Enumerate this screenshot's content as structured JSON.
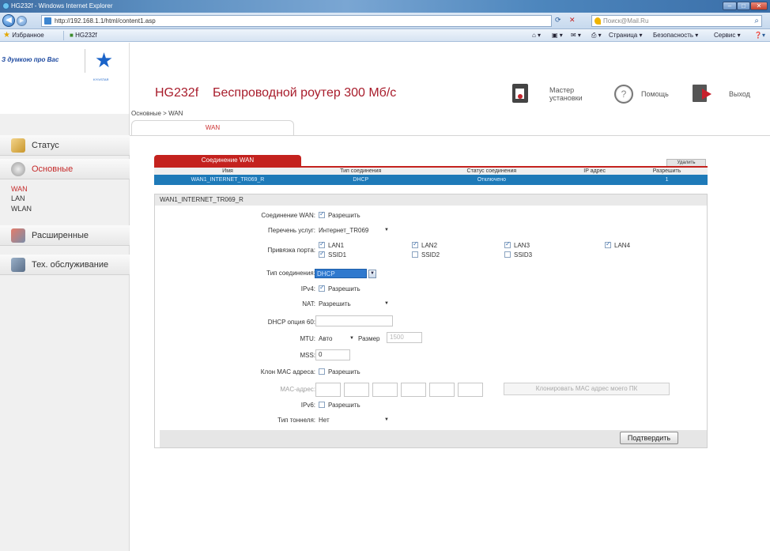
{
  "browser": {
    "window_title": "HG232f - Windows Internet Explorer",
    "url": "http://192.168.1.1/html/content1.asp",
    "search_placeholder": "Поиск@Mail.Ru",
    "favorites_label": "Избранное",
    "fav_tab_label": "HG232f",
    "commands": [
      "Страница ▾",
      "Безопасность ▾",
      "Сервис ▾"
    ]
  },
  "header": {
    "logo_slogan": "З думкою про Вас",
    "logo_brand": "KYIVSTAR",
    "model": "HG232f",
    "product": "Беспроводной роутер 300 Мб/с",
    "wizard_line1": "Мастер",
    "wizard_line2": "установки",
    "help": "Помощь",
    "exit": "Выход"
  },
  "breadcrumb": "Основные > WAN",
  "top_tab": "WAN",
  "sidebar": {
    "menu": [
      {
        "label": "Статус"
      },
      {
        "label": "Основные"
      },
      {
        "label": "Расширенные"
      },
      {
        "label": "Тех. обслуживание"
      }
    ],
    "sub": [
      "WAN",
      "LAN",
      "WLAN"
    ]
  },
  "wan_table": {
    "tab": "Соединение WAN",
    "delete_button": "Удалить",
    "headers": [
      "Имя",
      "Тип соединения",
      "Статус соединения",
      "IP адрес",
      "Разрешить"
    ],
    "row": [
      "WAN1_INTERNET_TR069_R",
      "DHCP",
      "Отключено",
      "",
      "1"
    ]
  },
  "form": {
    "title": "WAN1_INTERNET_TR069_R",
    "labels": {
      "wan_conn": "Соединение WAN:",
      "service_list": "Перечень услуг:",
      "port_binding": "Привязка порта:",
      "conn_type": "Тип соединения:",
      "ipv4": "IPv4:",
      "nat": "NAT:",
      "dhcp60": "DHCP опция 60:",
      "mtu": "MTU:",
      "mss": "MSS:",
      "mac_clone": "Клон MAC адреса:",
      "mac_addr": "MAC-адрес:",
      "ipv6": "IPv6:",
      "tunnel_type": "Тип тоннеля:"
    },
    "allow": "Разрешить",
    "service_list_value": "Интернет_TR069",
    "ports": [
      "LAN1",
      "LAN2",
      "LAN3",
      "LAN4",
      "SSID1",
      "SSID2",
      "SSID3"
    ],
    "port_checked": [
      true,
      true,
      true,
      true,
      true,
      false,
      false
    ],
    "conn_type_value": "DHCP",
    "nat_value": "Разрешить",
    "dhcp60_value": "",
    "mtu_value": "Авто",
    "size_label": "Размер",
    "size_value": "1500",
    "mss_value": "0",
    "clone_button": "Клонировать MAC адрес моего ПК",
    "tunnel_value": "Нет",
    "confirm_button": "Подтвердить"
  }
}
